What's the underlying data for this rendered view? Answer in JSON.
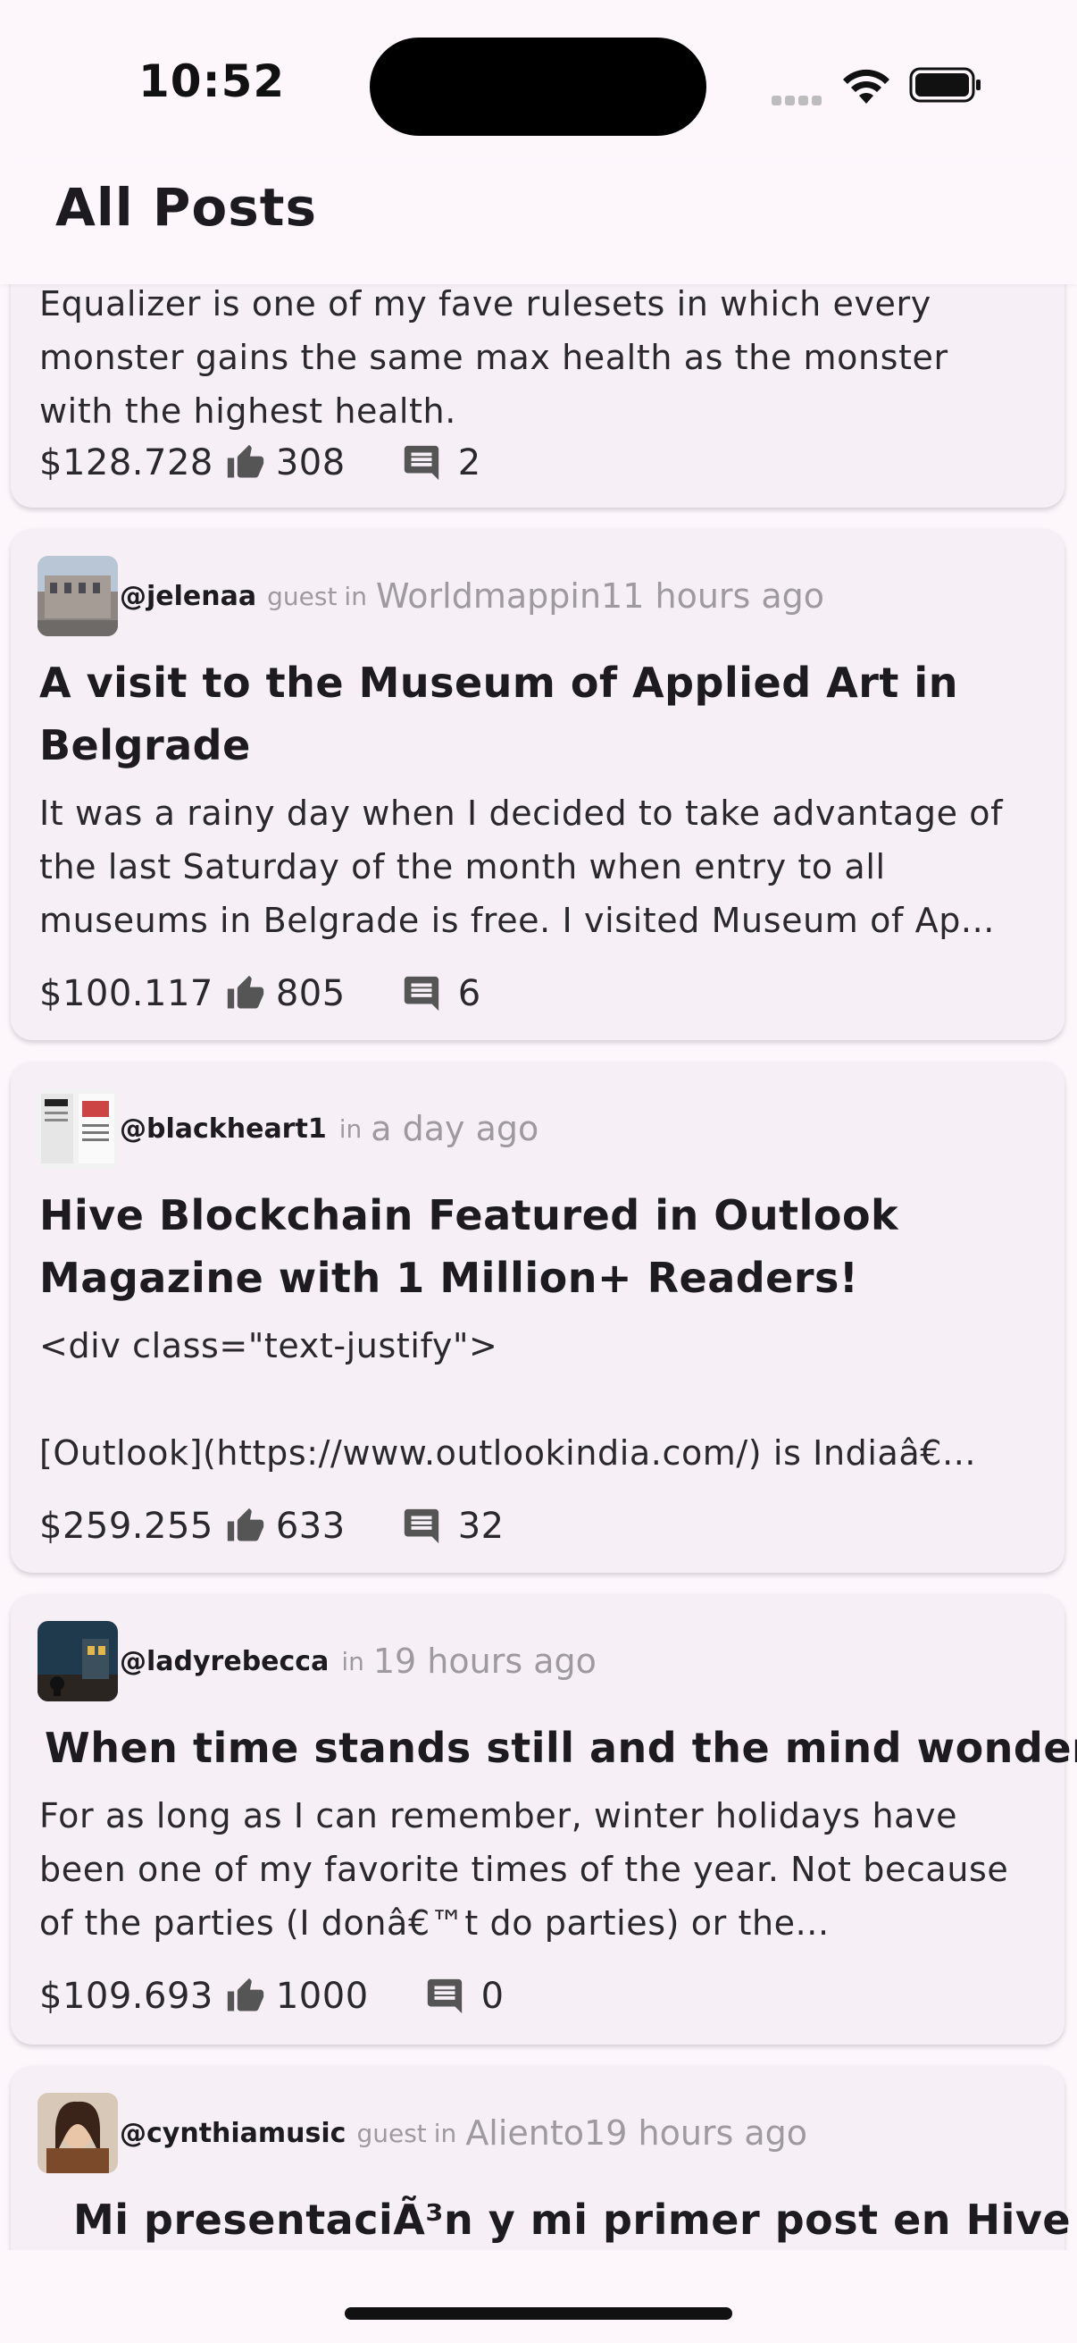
{
  "status": {
    "time": "10:52"
  },
  "app_bar": {
    "title": "All Posts"
  },
  "posts": [
    {
      "excerpt_lines": [
        "Equalizer is one of my fave rulesets in which every",
        "monster gains the same max health as the monster",
        "with the highest health."
      ],
      "payout": "$128.728",
      "votes": "308",
      "comments": "2"
    },
    {
      "author": "@jelenaa",
      "role": "guest",
      "in_label": "in",
      "community": "Worldmappin",
      "ago": "11 hours ago",
      "title": "A visit to the Museum of Applied Art in Belgrade",
      "excerpt": "It was a rainy day when I decided to take advantage of the last Saturday of the month when entry to all museums in Belgrade is free. I visited Museum of Ap...",
      "payout": "$100.117",
      "votes": "805",
      "comments": "6"
    },
    {
      "author": "@blackheart1",
      "in_label": "in",
      "ago": "a day ago",
      "title": "Hive Blockchain Featured in Outlook Magazine with 1 Million+ Readers!",
      "excerpt_line1": "<div class=\"text-justify\">",
      "excerpt_line3": "[Outlook](https://www.outlookindia.com/) is Indiaâ€...",
      "payout": "$259.255",
      "votes": "633",
      "comments": "32"
    },
    {
      "author": "@ladyrebecca",
      "in_label": "in",
      "ago": "19 hours ago",
      "title": "When time stands still and the mind wonders",
      "excerpt": "For as long as I can remember, winter holidays have been one of my favorite times of the year. Not because of the parties (I donâ€™t do parties) or the...",
      "payout": "$109.693",
      "votes": "1000",
      "comments": "0"
    },
    {
      "author": "@cynthiamusic",
      "role": "guest",
      "in_label": "in",
      "community": "Aliento",
      "ago": "19 hours ago",
      "title": "Mi presentaciÃ³n y mi primer post en Hive"
    }
  ],
  "icons": {
    "upvote": "thumb-up-icon",
    "comments": "comment-icon"
  },
  "colors": {
    "background": "#fdf7fc",
    "card": "#f6eff5",
    "muted": "#9e9aa0",
    "text": "#1d1b20"
  }
}
